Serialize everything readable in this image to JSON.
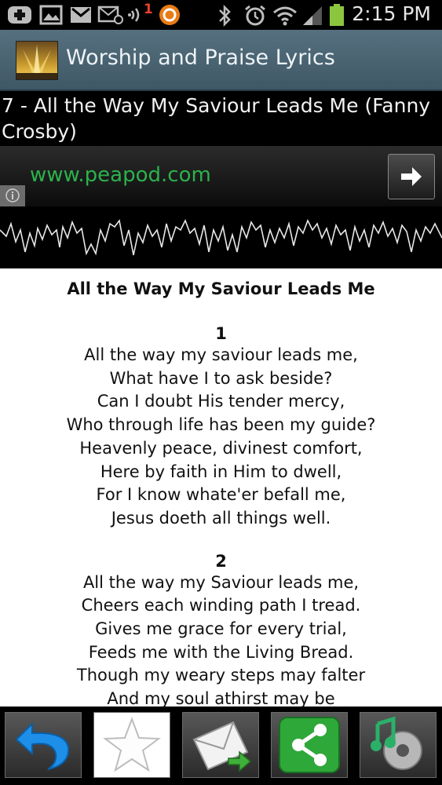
{
  "status_bar": {
    "time": "2:15 PM",
    "notification_count": "1",
    "icons": [
      "add-icon",
      "gallery-icon",
      "gmail-icon",
      "email-icon",
      "volume-icon",
      "sync-icon",
      "bluetooth-icon",
      "alarm-icon",
      "wifi-icon",
      "signal-icon",
      "battery-icon"
    ]
  },
  "app_bar": {
    "title": "Worship and Praise Lyrics",
    "logo_icon": "app-logo-icon"
  },
  "song": {
    "header": "7 - All the Way My Saviour Leads Me (Fanny Crosby)"
  },
  "ad": {
    "url": "www.peapod.com",
    "accent_color": "#2bb24c"
  },
  "lyrics": {
    "title": "All the Way My Saviour Leads Me",
    "verses": [
      {
        "number": "1",
        "lines": [
          "All the way my saviour leads me,",
          "What have I to ask beside?",
          "Can I doubt His tender mercy,",
          "Who through life has been my guide?",
          "Heavenly peace, divinest comfort,",
          "Here by faith in Him to dwell,",
          "For I know whate'er befall me,",
          "Jesus doeth all things well."
        ]
      },
      {
        "number": "2",
        "lines": [
          "All the way my Saviour leads me,",
          "Cheers each winding path I tread.",
          "Gives me grace for every trial,",
          "Feeds me with the Living Bread.",
          "Though my weary steps may falter",
          "And my soul athirst may be"
        ]
      }
    ]
  },
  "toolbar": {
    "buttons": [
      "back-icon",
      "favorite-star-icon",
      "email-forward-icon",
      "share-icon",
      "music-player-icon"
    ]
  }
}
